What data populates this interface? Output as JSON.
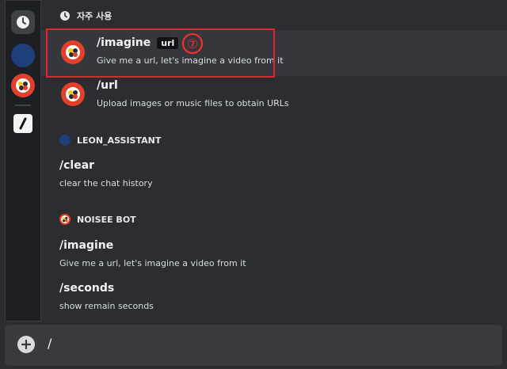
{
  "sidebar": {
    "icons": [
      "clock-icon",
      "leon-assistant-avatar",
      "noisee-bot-avatar",
      "slash-command-icon"
    ]
  },
  "sections": [
    {
      "title": "자주 사용",
      "icon": "clock-icon",
      "commands": [
        {
          "name": "/imagine",
          "param": "url",
          "desc": "Give me a url, let's imagine a video from it"
        },
        {
          "name": "/url",
          "param": "",
          "desc": "Upload images or music files to obtain URLs"
        }
      ]
    },
    {
      "title": "LEON_ASSISTANT",
      "icon": "leon-assistant-avatar",
      "commands": [
        {
          "name": "/clear",
          "desc": "clear the chat history"
        }
      ]
    },
    {
      "title": "NOISEE BOT",
      "icon": "noisee-bot-avatar",
      "commands": [
        {
          "name": "/imagine",
          "desc": "Give me a url, let's imagine a video from it"
        },
        {
          "name": "/seconds",
          "desc": "show remain seconds"
        }
      ]
    }
  ],
  "annotation": {
    "step": "⑦"
  },
  "input": {
    "value": "/"
  },
  "colors": {
    "background": "#2b2d31",
    "highlight": "#35373c",
    "annotation_red": "#e0262c",
    "noisee_red": "#e3402c",
    "leon_blue": "#1f3f7a"
  }
}
